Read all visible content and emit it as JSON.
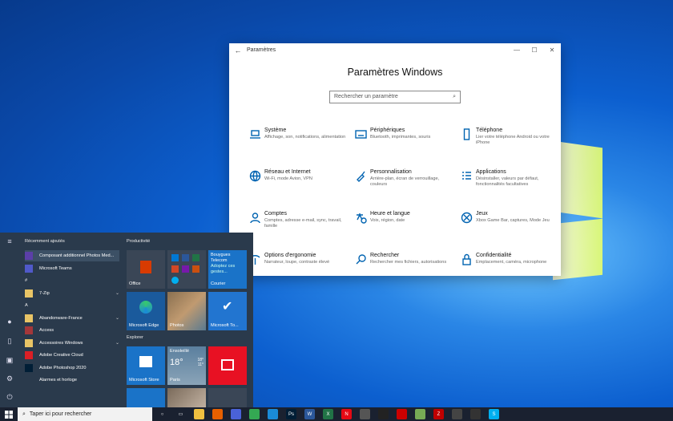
{
  "settings_window": {
    "window_title": "Paramètres",
    "heading": "Paramètres Windows",
    "search_placeholder": "Rechercher un paramètre",
    "categories": [
      {
        "name": "Système",
        "desc": "Affichage, son, notifications, alimentation",
        "icon": "laptop-icon"
      },
      {
        "name": "Périphériques",
        "desc": "Bluetooth, imprimantes, souris",
        "icon": "keyboard-icon"
      },
      {
        "name": "Téléphone",
        "desc": "Lier votre téléphone Android ou votre iPhone",
        "icon": "phone-icon"
      },
      {
        "name": "Réseau et Internet",
        "desc": "Wi-Fi, mode Avion, VPN",
        "icon": "globe-icon"
      },
      {
        "name": "Personnalisation",
        "desc": "Arrière-plan, écran de verrouillage, couleurs",
        "icon": "brush-icon"
      },
      {
        "name": "Applications",
        "desc": "Désinstaller, valeurs par défaut, fonctionnalités facultatives",
        "icon": "apps-list-icon"
      },
      {
        "name": "Comptes",
        "desc": "Comptes, adresse e-mail, sync, travail, famille",
        "icon": "person-icon"
      },
      {
        "name": "Heure et langue",
        "desc": "Voix, région, date",
        "icon": "time-language-icon"
      },
      {
        "name": "Jeux",
        "desc": "Xbox Game Bar, captures, Mode Jeu",
        "icon": "xbox-icon"
      },
      {
        "name": "Options d'ergonomie",
        "desc": "Narrateur, loupe, contraste élevé",
        "icon": "ease-of-access-icon"
      },
      {
        "name": "Rechercher",
        "desc": "Rechercher mes fichiers, autorisations",
        "icon": "search-icon"
      },
      {
        "name": "Confidentialité",
        "desc": "Emplacement, caméra, microphone",
        "icon": "lock-icon"
      }
    ]
  },
  "start_menu": {
    "recent_header": "Récemment ajoutés",
    "apps": [
      {
        "label": "Composant additionnel Photos Med...",
        "color": "#5b3fa8",
        "selected": true
      },
      {
        "label": "Microsoft Teams",
        "color": "#5059c9"
      },
      {
        "label": "#",
        "letter": true
      },
      {
        "label": "7-Zip",
        "color": "#e8c466",
        "expand": true
      },
      {
        "label": "A",
        "letter": true
      },
      {
        "label": "Abandonware-France",
        "color": "#e8c466",
        "expand": true
      },
      {
        "label": "Access",
        "color": "#a4373a"
      },
      {
        "label": "Accessoires Windows",
        "color": "#e8c466",
        "expand": true
      },
      {
        "label": "Adobe Creative Cloud",
        "color": "#da1f26"
      },
      {
        "label": "Adobe Photoshop 2020",
        "color": "#001e36"
      },
      {
        "label": "Alarmes et horloge",
        "color": "#2a3a4c"
      }
    ],
    "groups": [
      "Productivité",
      "Explorer"
    ],
    "tiles": {
      "office": "Office",
      "bouygues": "Bouygues Telecom",
      "bouygues_sub": "Adoptez ces gestes...",
      "courier": "Courier",
      "edge": "Microsoft Edge",
      "photos": "Photos",
      "todo": "Microsoft To...",
      "store": "Microsoft Store",
      "weather_cond": "Ensoleillé",
      "weather_temp": "18°",
      "weather_hi": "18°",
      "weather_lo": "11°",
      "weather_city": "Paris"
    }
  },
  "taskbar": {
    "search_placeholder": "Taper ici pour rechercher",
    "icons": [
      {
        "name": "cortana-icon",
        "color": "#1a2130",
        "glyph": "○"
      },
      {
        "name": "task-view-icon",
        "color": "#1a2130",
        "glyph": "▭"
      },
      {
        "name": "file-explorer-icon",
        "color": "#f0c040",
        "glyph": ""
      },
      {
        "name": "firefox-icon",
        "color": "#e66000",
        "glyph": ""
      },
      {
        "name": "firefox-dev-icon",
        "color": "#4a62d8",
        "glyph": ""
      },
      {
        "name": "chrome-icon",
        "color": "#34a853",
        "glyph": ""
      },
      {
        "name": "edge-icon",
        "color": "#1a8bd8",
        "glyph": ""
      },
      {
        "name": "photoshop-icon",
        "color": "#001e36",
        "glyph": "Ps"
      },
      {
        "name": "word-icon",
        "color": "#2b579a",
        "glyph": "W"
      },
      {
        "name": "excel-icon",
        "color": "#217346",
        "glyph": "X"
      },
      {
        "name": "netflix-icon",
        "color": "#e50914",
        "glyph": "N"
      },
      {
        "name": "app-icon",
        "color": "#555",
        "glyph": ""
      },
      {
        "name": "app-icon",
        "color": "#222",
        "glyph": ""
      },
      {
        "name": "app-icon",
        "color": "#c00",
        "glyph": ""
      },
      {
        "name": "app-icon",
        "color": "#7a5",
        "glyph": ""
      },
      {
        "name": "filezilla-icon",
        "color": "#bf0000",
        "glyph": "Z"
      },
      {
        "name": "app-icon",
        "color": "#444",
        "glyph": ""
      },
      {
        "name": "app-icon",
        "color": "#333",
        "glyph": ""
      },
      {
        "name": "skype-icon",
        "color": "#00aff0",
        "glyph": "S"
      },
      {
        "name": "app-icon",
        "color": "#1a2130",
        "glyph": ""
      },
      {
        "name": "app-icon",
        "color": "#1a2130",
        "glyph": ""
      },
      {
        "name": "app-icon",
        "color": "#1a2130",
        "glyph": ""
      }
    ]
  }
}
